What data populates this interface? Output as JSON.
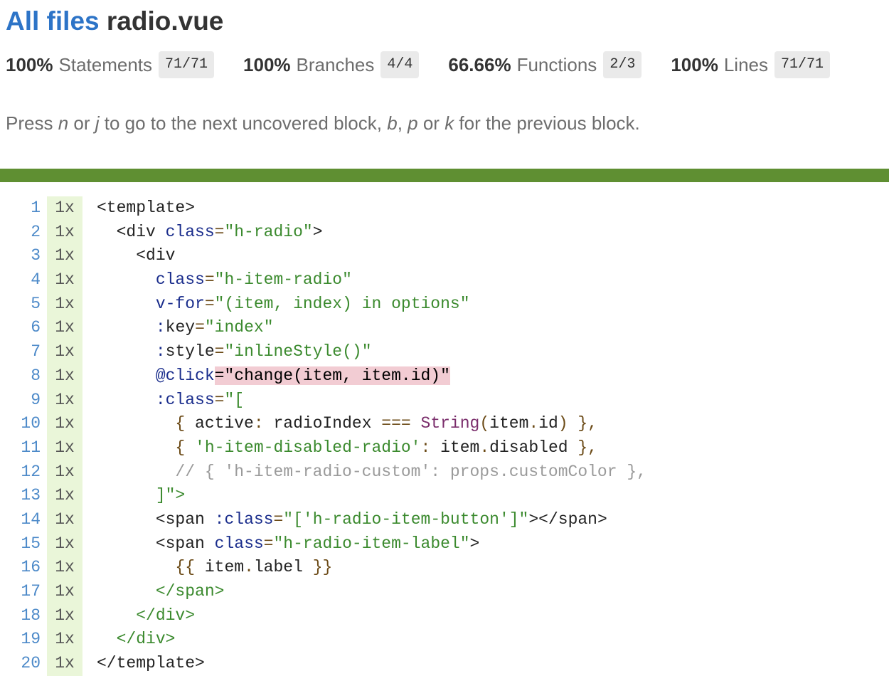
{
  "header": {
    "breadcrumb_link": "All files",
    "file_name": "radio.vue"
  },
  "summary": [
    {
      "pct": "100%",
      "label": "Statements",
      "frac": "71/71"
    },
    {
      "pct": "100%",
      "label": "Branches",
      "frac": "4/4"
    },
    {
      "pct": "66.66%",
      "label": "Functions",
      "frac": "2/3"
    },
    {
      "pct": "100%",
      "label": "Lines",
      "frac": "71/71"
    }
  ],
  "hint": {
    "t1": "Press ",
    "k1": "n",
    "t2": " or ",
    "k2": "j",
    "t3": " to go to the next uncovered block, ",
    "k3": "b",
    "t4": ", ",
    "k4": "p",
    "t5": " or ",
    "k5": "k",
    "t6": " for the previous block."
  },
  "colors": {
    "link": "#2d74c7",
    "status_bar": "#5f8f32",
    "covered_bg": "#eaf6d9",
    "uncovered_highlight": "#f2ccd3"
  },
  "code_lines": [
    {
      "n": "1",
      "count": "1x",
      "tokens": [
        [
          "tg",
          "<template>"
        ]
      ]
    },
    {
      "n": "2",
      "count": "1x",
      "tokens": [
        [
          "",
          "  "
        ],
        [
          "tg",
          "<div "
        ],
        [
          "at",
          "class"
        ],
        [
          "op",
          "="
        ],
        [
          "st",
          "\"h-radio\""
        ],
        [
          "tg",
          ">"
        ]
      ]
    },
    {
      "n": "3",
      "count": "1x",
      "tokens": [
        [
          "",
          "    "
        ],
        [
          "tg",
          "<div"
        ]
      ]
    },
    {
      "n": "4",
      "count": "1x",
      "tokens": [
        [
          "",
          "      "
        ],
        [
          "at",
          "class"
        ],
        [
          "op",
          "="
        ],
        [
          "st",
          "\"h-item-radio\""
        ]
      ]
    },
    {
      "n": "5",
      "count": "1x",
      "tokens": [
        [
          "",
          "      "
        ],
        [
          "at",
          "v-for"
        ],
        [
          "op",
          "="
        ],
        [
          "st",
          "\"(item, index) in options\""
        ]
      ]
    },
    {
      "n": "6",
      "count": "1x",
      "tokens": [
        [
          "",
          "      "
        ],
        [
          "at",
          ":"
        ],
        [
          "tg",
          "key"
        ],
        [
          "op",
          "="
        ],
        [
          "st",
          "\"index\""
        ]
      ]
    },
    {
      "n": "7",
      "count": "1x",
      "tokens": [
        [
          "",
          "      "
        ],
        [
          "at",
          ":"
        ],
        [
          "tg",
          "style"
        ],
        [
          "op",
          "="
        ],
        [
          "st",
          "\"inlineStyle()\""
        ]
      ]
    },
    {
      "n": "8",
      "count": "1x",
      "tokens": [
        [
          "",
          "      "
        ],
        [
          "at",
          "@click"
        ],
        [
          "uncov",
          "=\"change(item, item.id)\""
        ]
      ]
    },
    {
      "n": "9",
      "count": "1x",
      "tokens": [
        [
          "",
          "      "
        ],
        [
          "at",
          ":class"
        ],
        [
          "op",
          "="
        ],
        [
          "st",
          "\"["
        ]
      ]
    },
    {
      "n": "10",
      "count": "1x",
      "tokens": [
        [
          "",
          "        "
        ],
        [
          "op",
          "{ "
        ],
        [
          "tg",
          "active"
        ],
        [
          "op",
          ": "
        ],
        [
          "tg",
          "radioIndex "
        ],
        [
          "op",
          "=== "
        ],
        [
          "fn",
          "String"
        ],
        [
          "op",
          "("
        ],
        [
          "tg",
          "item"
        ],
        [
          "op",
          "."
        ],
        [
          "tg",
          "id"
        ],
        [
          "op",
          ") },"
        ]
      ]
    },
    {
      "n": "11",
      "count": "1x",
      "tokens": [
        [
          "",
          "        "
        ],
        [
          "op",
          "{ "
        ],
        [
          "st",
          "'h-item-disabled-radio'"
        ],
        [
          "op",
          ": "
        ],
        [
          "tg",
          "item"
        ],
        [
          "op",
          "."
        ],
        [
          "tg",
          "disabled "
        ],
        [
          "op",
          "},"
        ]
      ]
    },
    {
      "n": "12",
      "count": "1x",
      "tokens": [
        [
          "",
          "        "
        ],
        [
          "cm",
          "// { 'h-item-radio-custom': props.customColor },"
        ]
      ]
    },
    {
      "n": "13",
      "count": "1x",
      "tokens": [
        [
          "",
          "      "
        ],
        [
          "st",
          "]\">"
        ]
      ]
    },
    {
      "n": "14",
      "count": "1x",
      "tokens": [
        [
          "",
          "      "
        ],
        [
          "tg",
          "<span "
        ],
        [
          "at",
          ":class"
        ],
        [
          "op",
          "="
        ],
        [
          "st",
          "\"['h-radio-item-button']\""
        ],
        [
          "tg",
          "></span>"
        ]
      ]
    },
    {
      "n": "15",
      "count": "1x",
      "tokens": [
        [
          "",
          "      "
        ],
        [
          "tg",
          "<span "
        ],
        [
          "at",
          "class"
        ],
        [
          "op",
          "="
        ],
        [
          "st",
          "\"h-radio-item-label\""
        ],
        [
          "tg",
          ">"
        ]
      ]
    },
    {
      "n": "16",
      "count": "1x",
      "tokens": [
        [
          "",
          "        "
        ],
        [
          "op",
          "{{ "
        ],
        [
          "tg",
          "item"
        ],
        [
          "op",
          "."
        ],
        [
          "tg",
          "label "
        ],
        [
          "op",
          "}}"
        ]
      ]
    },
    {
      "n": "17",
      "count": "1x",
      "tokens": [
        [
          "",
          "      "
        ],
        [
          "st",
          "</span>"
        ]
      ]
    },
    {
      "n": "18",
      "count": "1x",
      "tokens": [
        [
          "",
          "    "
        ],
        [
          "st",
          "</div>"
        ]
      ]
    },
    {
      "n": "19",
      "count": "1x",
      "tokens": [
        [
          "",
          "  "
        ],
        [
          "st",
          "</div>"
        ]
      ]
    },
    {
      "n": "20",
      "count": "1x",
      "tokens": [
        [
          "tg",
          "</template>"
        ]
      ]
    }
  ]
}
